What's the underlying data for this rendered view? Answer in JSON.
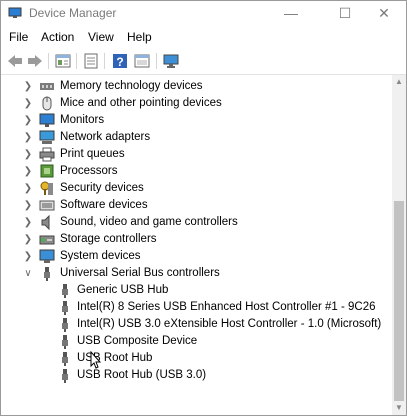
{
  "window": {
    "title": "Device Manager",
    "buttons": {
      "minimize": "—",
      "maximize": "☐",
      "close": "✕"
    }
  },
  "menu": [
    "File",
    "Action",
    "View",
    "Help"
  ],
  "toolbar": [
    "back-icon",
    "forward-icon",
    "properties-icon",
    "refresh-icon",
    "help-icon",
    "view-icon",
    "monitor-icon"
  ],
  "tree": {
    "categories": [
      {
        "label": "Memory technology devices",
        "icon": "memory-icon",
        "expanded": false
      },
      {
        "label": "Mice and other pointing devices",
        "icon": "mouse-icon",
        "expanded": false
      },
      {
        "label": "Monitors",
        "icon": "monitor-icon",
        "expanded": false
      },
      {
        "label": "Network adapters",
        "icon": "network-icon",
        "expanded": false
      },
      {
        "label": "Print queues",
        "icon": "printer-icon",
        "expanded": false
      },
      {
        "label": "Processors",
        "icon": "processor-icon",
        "expanded": false
      },
      {
        "label": "Security devices",
        "icon": "security-icon",
        "expanded": false
      },
      {
        "label": "Software devices",
        "icon": "software-icon",
        "expanded": false
      },
      {
        "label": "Sound, video and game controllers",
        "icon": "speaker-icon",
        "expanded": false
      },
      {
        "label": "Storage controllers",
        "icon": "storage-icon",
        "expanded": false
      },
      {
        "label": "System devices",
        "icon": "system-icon",
        "expanded": false
      },
      {
        "label": "Universal Serial Bus controllers",
        "icon": "usb-icon",
        "expanded": true
      }
    ],
    "usb_children": [
      "Generic USB Hub",
      "Intel(R) 8 Series USB Enhanced Host Controller #1 - 9C26",
      "Intel(R) USB 3.0 eXtensible Host Controller - 1.0 (Microsoft)",
      "USB Composite Device",
      "USB Root Hub",
      "USB Root Hub (USB 3.0)"
    ]
  },
  "colors": {
    "accent": "#1e73c8",
    "title_text": "#7a7a7a"
  }
}
